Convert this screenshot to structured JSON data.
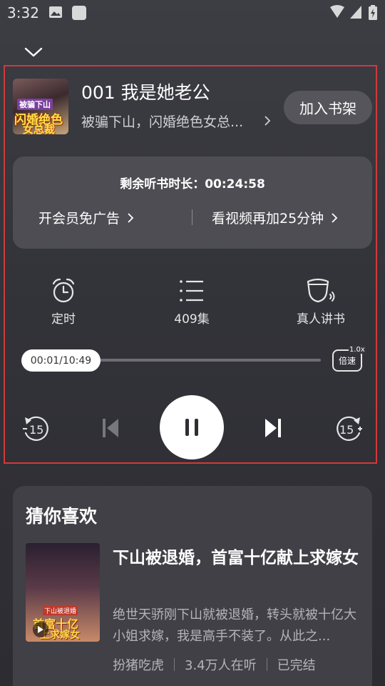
{
  "status_bar": {
    "time": "3:32",
    "left_icons": [
      "image-icon",
      "app-icon"
    ],
    "right_icons": [
      "wifi-icon",
      "signal-icon",
      "battery-icon"
    ]
  },
  "player": {
    "collapse_icon": "chevron-down-icon",
    "cover_text": {
      "tag": "被骗下山",
      "line1": "闪婚绝色",
      "line2": "女总裁"
    },
    "episode_title": "001 我是她老公",
    "book_subtitle": "被骗下山，闪婚绝色女总...",
    "shelf_button": "加入书架",
    "remaining": {
      "label": "剩余听书时长：",
      "value": "00:24:58"
    },
    "vip_link": "开会员免广告",
    "video_link": "看视频再加25分钟",
    "functions": [
      {
        "icon": "alarm-clock-icon",
        "label": "定时"
      },
      {
        "icon": "playlist-icon",
        "label": "409集"
      },
      {
        "icon": "narrator-icon",
        "label": "真人讲书"
      }
    ],
    "progress": {
      "time_label": "00:01/10:49",
      "fraction": 0.0015
    },
    "speed": {
      "label": "倍速",
      "value": "1.0x"
    },
    "controls": {
      "rewind_label": "15",
      "forward_label": "15",
      "state": "playing"
    }
  },
  "recommend": {
    "heading": "猜你喜欢",
    "book": {
      "cover_text": {
        "tag": "下山被退婚",
        "line1": "首富十亿",
        "line2": "上求嫁女"
      },
      "title": "下山被退婚，首富十亿献上求嫁女",
      "description": "绝世天骄刚下山就被退婚，转头就被十亿大小姐求嫁，我是高手不装了。从此之...",
      "tags": [
        "扮猪吃虎",
        "3.4万人在听",
        "已完结"
      ]
    }
  },
  "colors": {
    "accent_border": "#d23a3a",
    "card_bg": "#4d4d53",
    "button_bg": "#55555b"
  }
}
